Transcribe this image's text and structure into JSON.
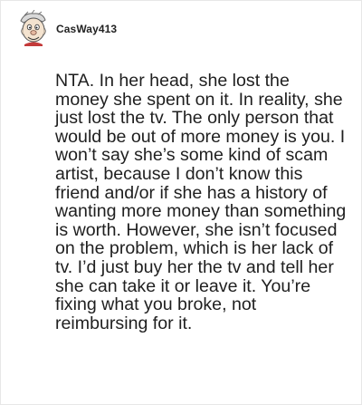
{
  "comment": {
    "author": {
      "username": "CasWay413",
      "avatar_icon": "cartoon-face-avatar-icon"
    },
    "body": "NTA. In her head, she lost the money she spent on it. In reality, she just lost the tv. The only person that would be out of more money is you. I won’t say she’s some kind of scam artist, because I don’t know this friend and/or if she has a history of wanting more money than something is worth. However, she isn’t focused on the problem, which is her lack of tv. I’d just buy her the tv and tell her she can take it or leave it. You’re fixing what you broke, not reimbursing for it."
  }
}
